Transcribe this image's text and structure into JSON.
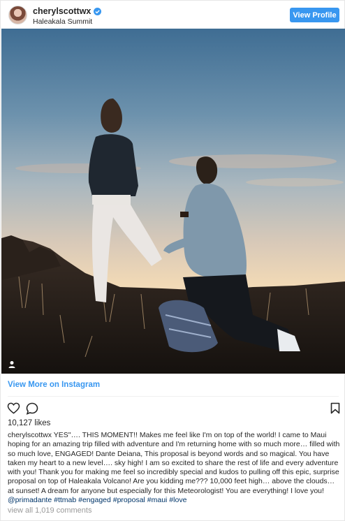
{
  "post": {
    "username": "cherylscottwx",
    "location": "Haleakala Summit",
    "view_profile_label": "View Profile",
    "view_more_label": "View More on Instagram",
    "likes": "10,127 likes",
    "caption_user": "cherylscottwx",
    "caption_text": " YES\"…. THIS MOMENT!! Makes me feel like I'm on top of the world! I came to Maui hoping for an amazing trip filled with adventure and I'm returning home with so much more… filled with so much love, ENGAGED! Dante Deiana, This proposal is beyond words and so magical. You have taken my heart to a new level…. sky high! I am so excited to share the rest of life and every adventure with you! Thank you for making me feel so incredibly special and kudos to pulling off this epic, surprise proposal on top of Haleakala Volcano! Are you kidding me??? 10,000 feet high… above the clouds… at sunset! A dream for anyone but especially for this Meteorologist! You are everything! I love you! ",
    "caption_tags": "@primadante #ttmab #engaged #proposal #maui #love",
    "view_all_comments": "view all 1,019 comments"
  },
  "icons": {
    "verified": "verified-badge-icon",
    "heart": "heart-icon",
    "comment": "comment-icon",
    "bookmark": "bookmark-icon",
    "tagged_user": "person-icon"
  },
  "colors": {
    "accent": "#3897f0",
    "link": "#003569",
    "muted": "#999999"
  }
}
